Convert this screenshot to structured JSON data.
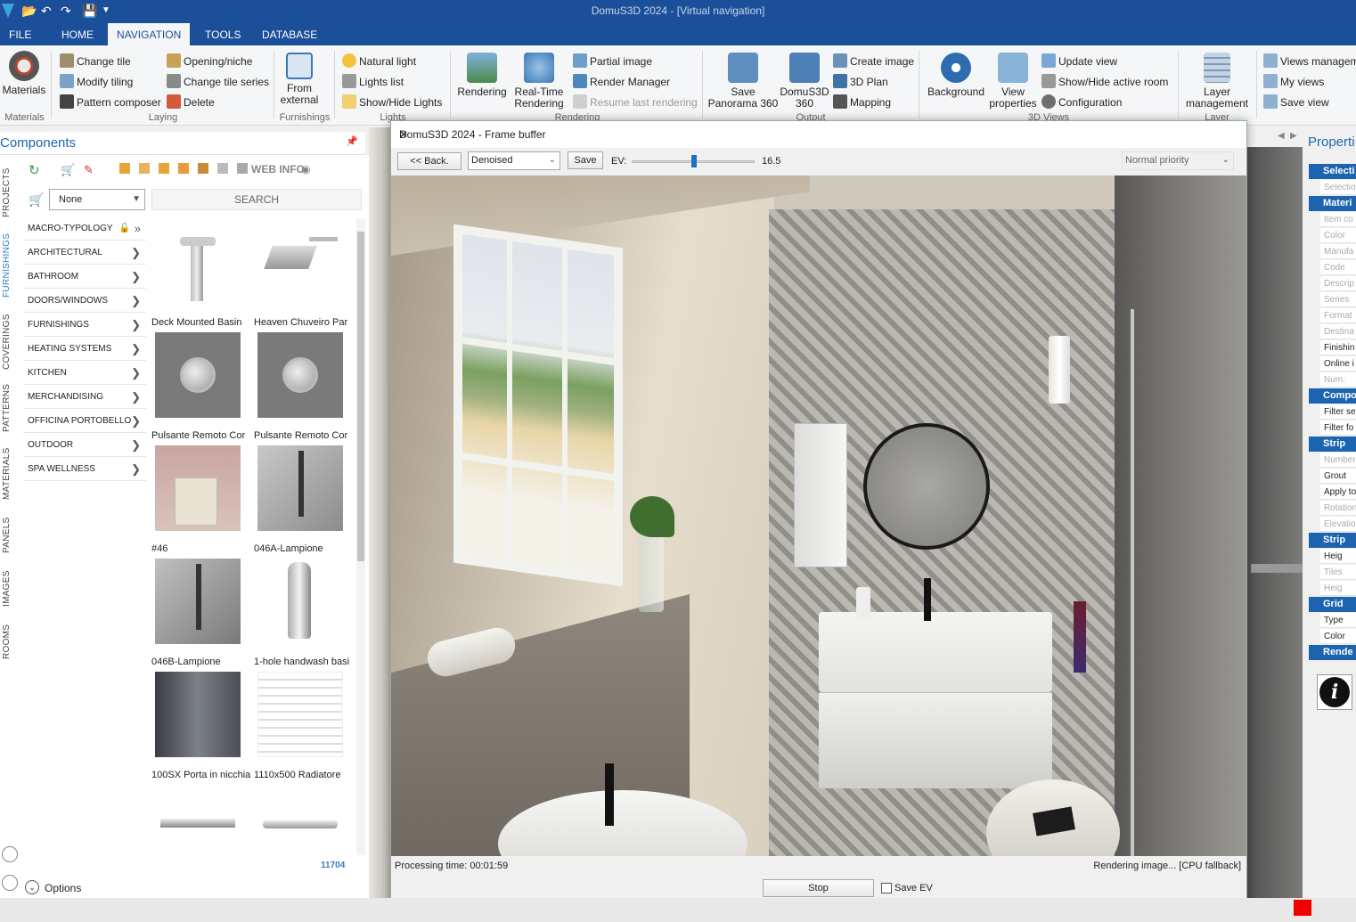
{
  "app_title": "DomuS3D 2024 - [Virtual navigation]",
  "tabs": [
    {
      "label": "FILE"
    },
    {
      "label": "HOME"
    },
    {
      "label": "NAVIGATION"
    },
    {
      "label": "TOOLS"
    },
    {
      "label": "DATABASE"
    }
  ],
  "ribbon": {
    "materials": "Materials",
    "grp_materials": "Materials",
    "change_tile": "Change tile",
    "modify_tiling": "Modify tiling",
    "pattern_composer": "Pattern composer",
    "opening_niche": "Opening/niche",
    "change_tile_series": "Change tile series",
    "delete": "Delete",
    "grp_laying": "Laying",
    "from_external": "From external",
    "grp_furnishings": "Furnishings",
    "natural_light": "Natural light",
    "lights_list": "Lights list",
    "show_hide_lights": "Show/Hide Lights",
    "grp_lights": "Lights",
    "rendering": "Rendering",
    "realtime_rendering": "Real-Time Rendering",
    "partial_image": "Partial image",
    "render_manager": "Render Manager",
    "resume_last": "Resume last rendering",
    "grp_rendering": "Rendering",
    "save_panorama": "Save Panorama 360",
    "domus360": "DomuS3D 360",
    "create_image": "Create image",
    "plan_3d": "3D Plan",
    "mapping": "Mapping",
    "grp_output": "Output",
    "background": "Background",
    "view_properties": "View properties",
    "update_view": "Update view",
    "show_hide_room": "Show/Hide active room",
    "configuration": "Configuration",
    "grp_3dviews": "3D Views",
    "layer_management": "Layer management",
    "grp_layer": "Layer",
    "views_management": "Views managem",
    "my_views": "My views",
    "save_view": "Save view"
  },
  "components": {
    "title": "Components",
    "web_info": "WEB INFO",
    "cart_value": "None",
    "search_label": "SEARCH",
    "side_tabs": [
      "PROJECTS",
      "FURNISHINGS",
      "COVERINGS",
      "PATTERNS",
      "MATERIALS",
      "PANELS",
      "IMAGES",
      "ROOMS"
    ],
    "categories": [
      "MACRO-TYPOLOGY",
      "ARCHITECTURAL",
      "BATHROOM",
      "DOORS/WINDOWS",
      "FURNISHINGS",
      "HEATING SYSTEMS",
      "KITCHEN",
      "MERCHANDISING",
      "OFFICINA PORTOBELLO",
      "OUTDOOR",
      "SPA WELLNESS"
    ],
    "items": [
      "Deck Mounted Basin",
      "Heaven Chuveiro Par",
      "Pulsante Remoto Cor",
      "Pulsante Remoto Cor",
      "#46",
      "046A-Lampione",
      "046B-Lampione",
      "1-hole handwash basi",
      "100SX Porta in nicchia",
      "1110x500 Radiatore",
      "",
      ""
    ],
    "count": "11704",
    "options": "Options"
  },
  "frame_buffer": {
    "title": "DomuS3D 2024 - Frame buffer",
    "back": "<< Back.",
    "mode": "Denoised",
    "save": "Save",
    "ev_label": "EV:",
    "ev_value": "16.5",
    "ev_level": 0.5,
    "priority": "Normal priority",
    "processing": "Processing time: 00:01:59",
    "status": "Rendering image... [CPU fallback]",
    "stop": "Stop",
    "save_ev": "Save EV"
  },
  "properties": {
    "title": "Properti",
    "rows": [
      {
        "t": "h",
        "v": "Selecti"
      },
      {
        "t": "g",
        "v": "Selectio"
      },
      {
        "t": "h",
        "v": "Materi"
      },
      {
        "t": "g",
        "v": "Item co"
      },
      {
        "t": "g",
        "v": "Color"
      },
      {
        "t": "g",
        "v": "Manufa"
      },
      {
        "t": "g",
        "v": "Code"
      },
      {
        "t": "g",
        "v": "Descrip"
      },
      {
        "t": "g",
        "v": "Series"
      },
      {
        "t": "g",
        "v": "Format"
      },
      {
        "t": "g",
        "v": "Destina"
      },
      {
        "t": "r",
        "v": "Finishin"
      },
      {
        "t": "r",
        "v": "Online i"
      },
      {
        "t": "g",
        "v": "Num."
      },
      {
        "t": "h",
        "v": "Compo"
      },
      {
        "t": "r",
        "v": "Filter se"
      },
      {
        "t": "r",
        "v": "Filter fo"
      },
      {
        "t": "h",
        "v": "Strip"
      },
      {
        "t": "g",
        "v": "Number"
      },
      {
        "t": "r",
        "v": "Grout"
      },
      {
        "t": "r",
        "v": "Apply to"
      },
      {
        "t": "g",
        "v": "Rotation"
      },
      {
        "t": "g",
        "v": "Elevatio"
      },
      {
        "t": "h",
        "v": "Strip"
      },
      {
        "t": "r",
        "v": "Heig"
      },
      {
        "t": "g",
        "v": "Tiles"
      },
      {
        "t": "g",
        "v": "Heig"
      },
      {
        "t": "h",
        "v": "Grid"
      },
      {
        "t": "r",
        "v": "Type"
      },
      {
        "t": "r",
        "v": "Color"
      },
      {
        "t": "h",
        "v": "Rende"
      }
    ]
  }
}
